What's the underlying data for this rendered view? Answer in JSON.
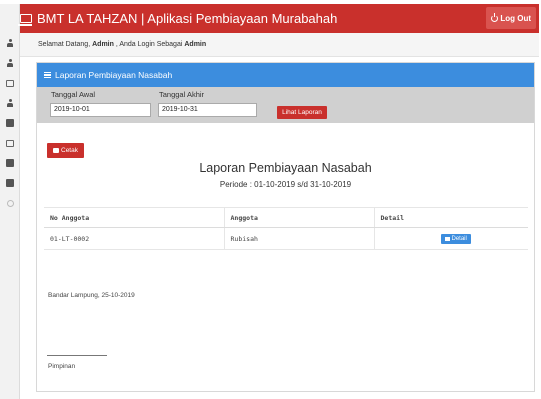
{
  "app": {
    "title": "BMT LA TAHZAN | Aplikasi Pembiayaan Murabahah"
  },
  "header": {
    "logout_label": "Log Out"
  },
  "sidebar": {
    "icons": [
      "users-icon",
      "user-icon",
      "check-square-icon",
      "user-icon",
      "book-icon",
      "edit-icon",
      "table-icon",
      "table-icon",
      "circle-icon"
    ]
  },
  "welcome": {
    "prefix": "Selamat Datang,",
    "user": "Admin",
    "middle": ", Anda Login Sebagai",
    "role": "Admin"
  },
  "panel": {
    "title": "Laporan Pembiayaan Nasabah"
  },
  "filter": {
    "start_label": "Tanggal Awal",
    "start_value": "2019-10-01",
    "end_label": "Tanggal Akhir",
    "end_value": "2019-10-31",
    "submit_label": "Lihat Laporan"
  },
  "report": {
    "print_label": "Cetak",
    "title": "Laporan Pembiayaan Nasabah",
    "period": "Periode : 01-10-2019 s/d 31-10-2019",
    "columns": [
      "No Anggota",
      "Anggota",
      "Detail"
    ],
    "rows": [
      {
        "no_anggota": "01-LT-0002",
        "anggota": "Rubisah",
        "detail_label": "Detail"
      }
    ],
    "place_date": "Bandar Lampung, 25-10-2019",
    "signature_label": "Pimpinan"
  },
  "colors": {
    "topbar": "#c9302c",
    "panel_header": "#3c8dde",
    "filter_bg": "#d0d0d0"
  }
}
